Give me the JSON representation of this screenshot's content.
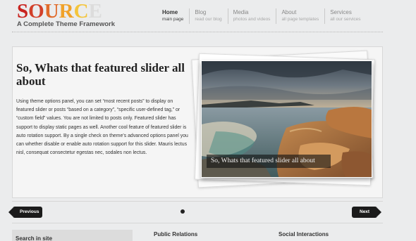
{
  "brand": {
    "logo_letters": [
      "S",
      "O",
      "U",
      "R",
      "C",
      "E"
    ],
    "logo_colors": [
      "#c8231f",
      "#d2402a",
      "#e06a2a",
      "#f0a22a",
      "#f4c53c",
      "#dcdcdc"
    ],
    "tagline": "A Complete Theme Framework"
  },
  "nav": {
    "items": [
      {
        "title": "Home",
        "subtitle": "main page",
        "active": true
      },
      {
        "title": "Blog",
        "subtitle": "read our blog",
        "active": false
      },
      {
        "title": "Media",
        "subtitle": "photos and videos",
        "active": false
      },
      {
        "title": "About",
        "subtitle": "all page templates",
        "active": false
      },
      {
        "title": "Services",
        "subtitle": "all our services",
        "active": false
      }
    ]
  },
  "featured": {
    "title": "So, Whats that featured slider all about",
    "body": "Using theme options panel, you can set “most recent posts” to display on featured slider or posts “based on a category”, “specific user-defined tag,” or “custom field” values. You are not limited to posts only. Featured slider has support to display static pages as well. Another cool feature of featured slider is auto rotation support. By a single check on theme’s advanced options panel you can whether disable or enable auto rotation support for this slider. Mauris lectus nisl, consequat consectetur egestas nec, sodales non lectus.",
    "caption": "So, Whats that featured slider all about",
    "image_icon": "coastal-landscape-photo"
  },
  "slider": {
    "prev_label": "Previous",
    "next_label": "Next"
  },
  "widgets": {
    "search_title": "Search in site",
    "public_relations_title": "Public Relations",
    "social_title": "Social Interactions"
  }
}
